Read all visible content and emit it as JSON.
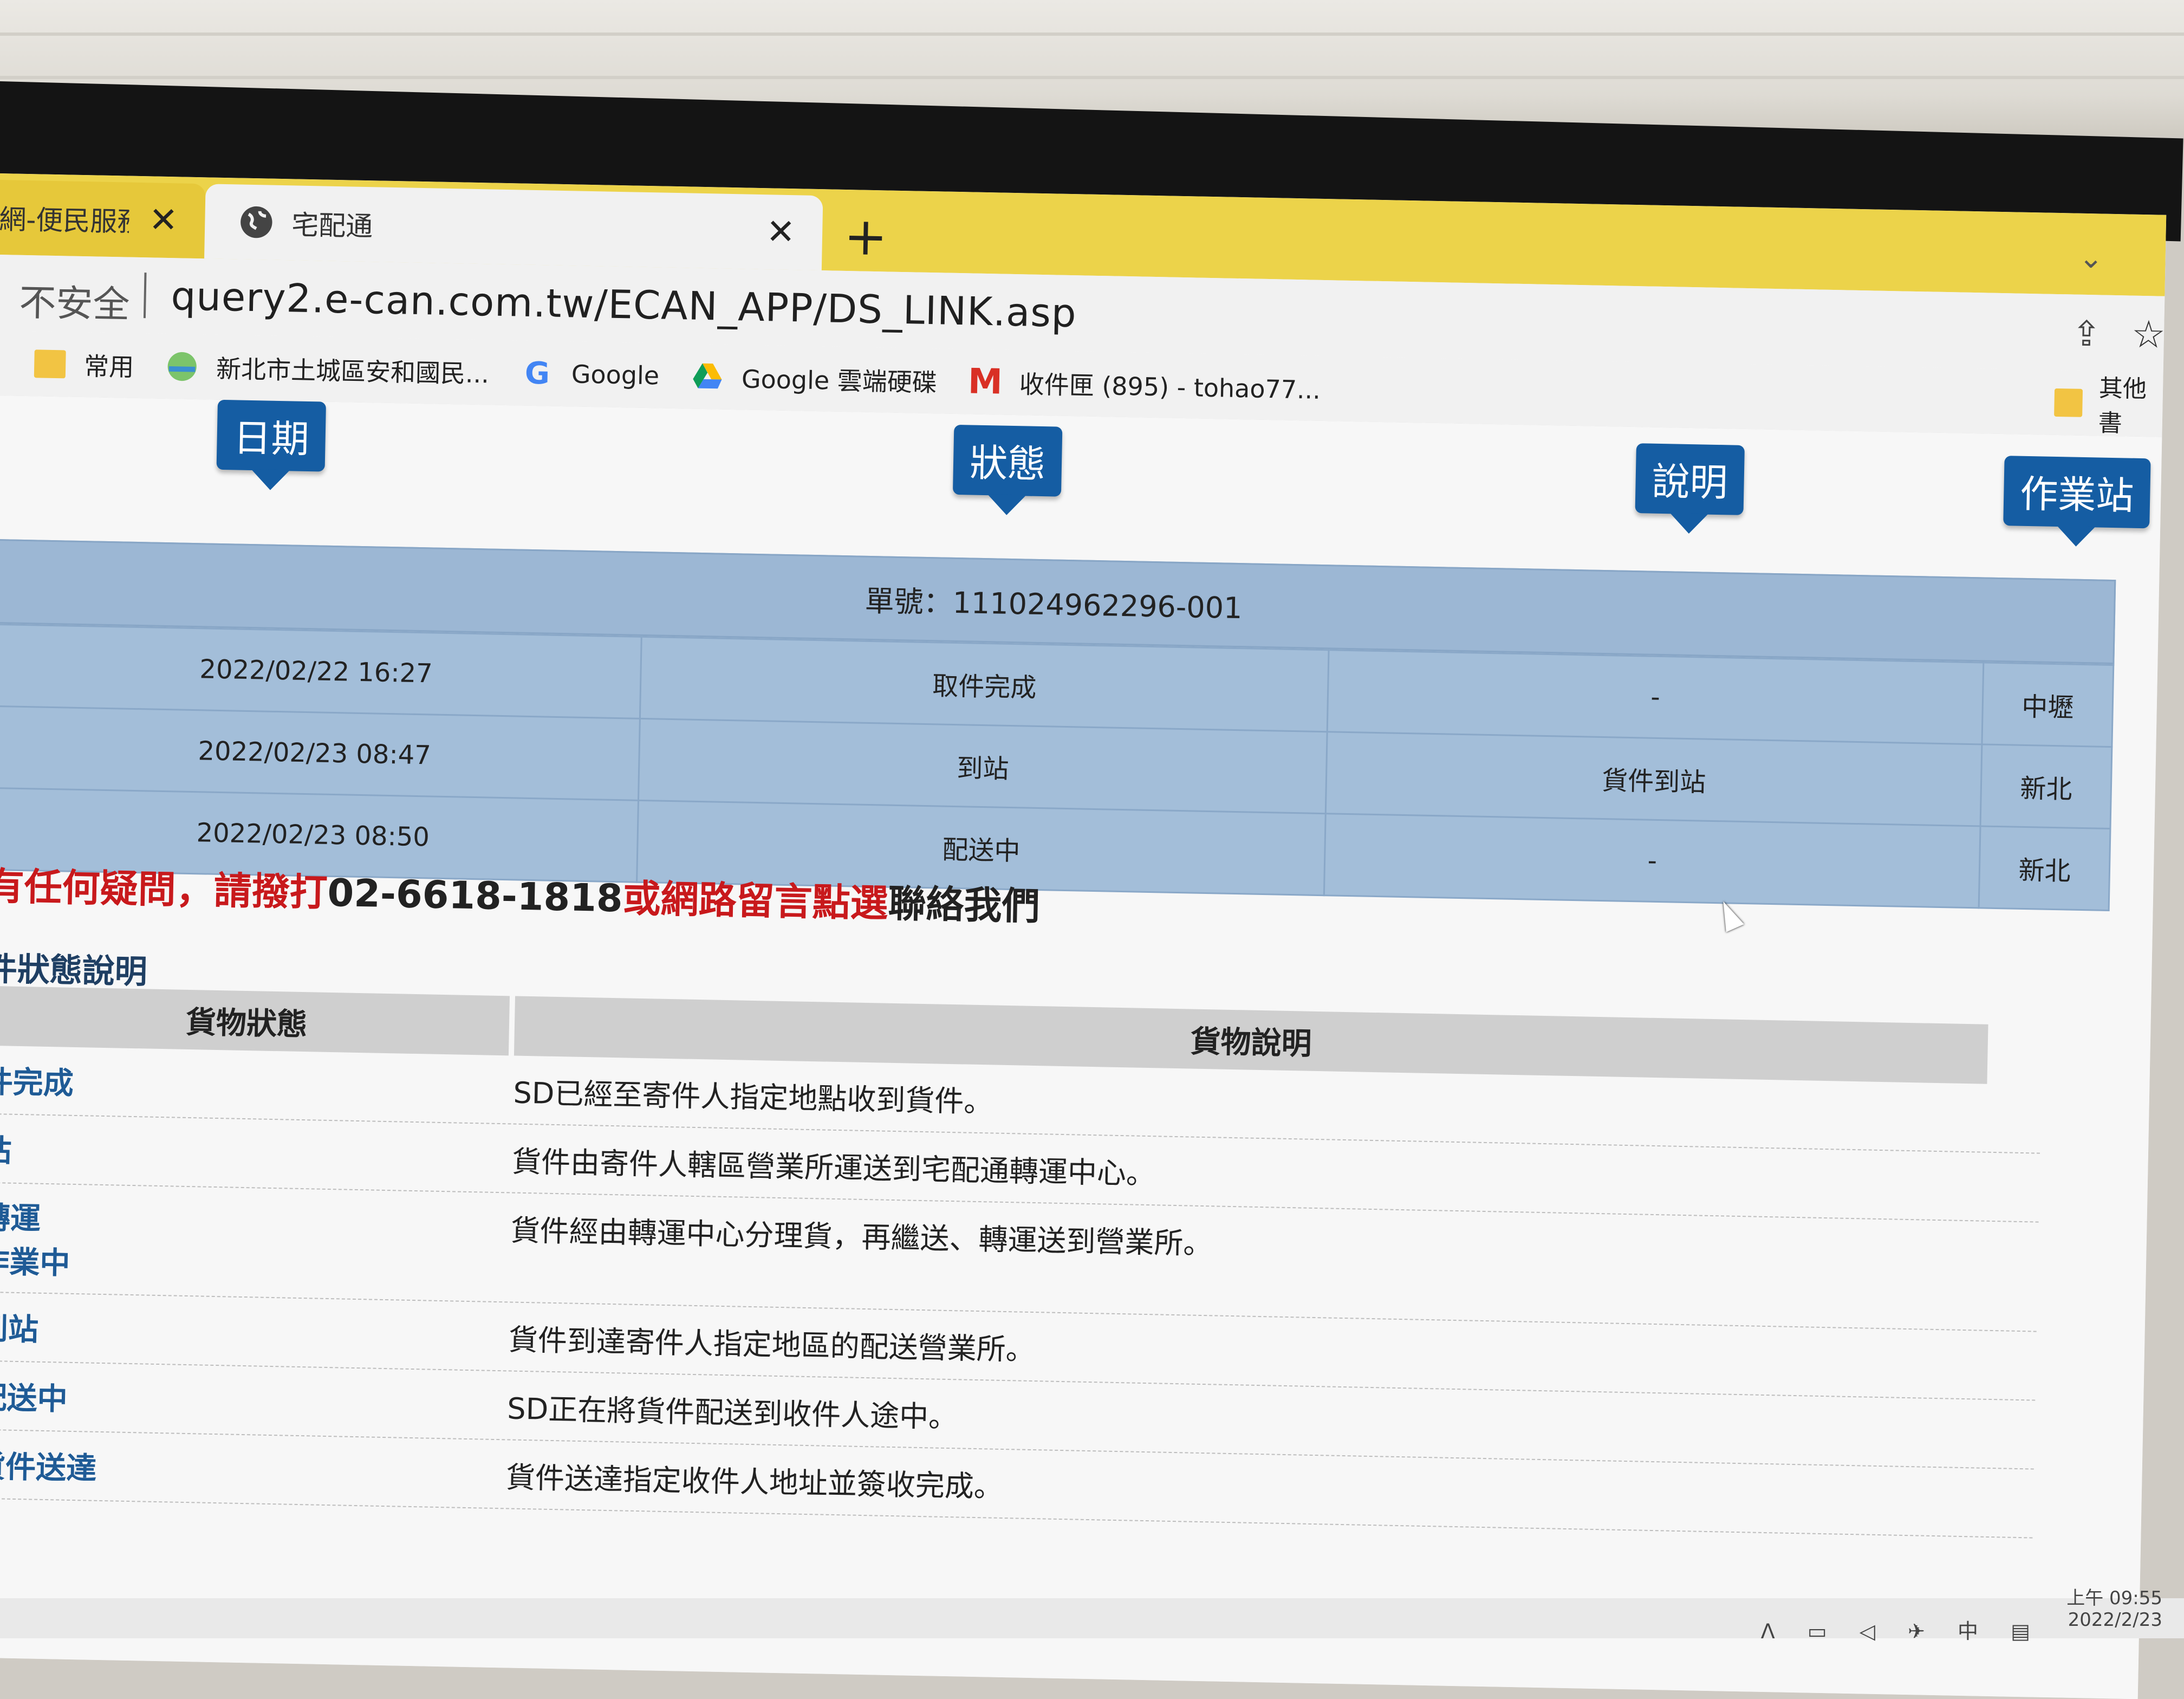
{
  "browser": {
    "tabs": [
      {
        "title": "網-便民服務",
        "close": "✕"
      },
      {
        "title": "宅配通",
        "close": "✕"
      }
    ],
    "new_tab": "+",
    "tab_menu": "⌄",
    "address": {
      "security": "不安全",
      "url": "query2.e-can.com.tw/ECAN_APP/DS_LINK.asp"
    },
    "bookmarks": [
      "常用",
      "新北市土城區安和國民...",
      "Google",
      "Google 雲端硬碟",
      "收件匣 (895) - tohao77..."
    ],
    "other_bookmarks": "其他書"
  },
  "tracking": {
    "columns": [
      "日期",
      "狀態",
      "說明",
      "作業站"
    ],
    "order_number": "單號：111024962296-001",
    "rows": [
      {
        "date": "2022/02/22 16:27",
        "status": "取件完成",
        "desc": "-",
        "station": "中壢"
      },
      {
        "date": "2022/02/23 08:47",
        "status": "到站",
        "desc": "貨件到站",
        "station": "新北"
      },
      {
        "date": "2022/02/23 08:50",
        "status": "配送中",
        "desc": "-",
        "station": "新北"
      }
    ]
  },
  "contact": {
    "part1": "有任何疑問，請撥打",
    "phone": "02-6618-1818",
    "part2": "或網路留言點選",
    "part3": "聯絡我們"
  },
  "legend": {
    "title": "件狀態說明",
    "headers": [
      "貨物狀態",
      "貨物說明"
    ],
    "rows": [
      {
        "status": "件完成",
        "desc": "SD已經至寄件人指定地點收到貨件。"
      },
      {
        "status": "站",
        "desc": "貨件由寄件人轄區營業所運送到宅配通轉運中心。"
      },
      {
        "status": "轉運",
        "status2": "作業中",
        "desc": "貨件經由轉運中心分理貨，再繼送、轉運送到營業所。"
      },
      {
        "status": "到站",
        "desc": "貨件到達寄件人指定地區的配送營業所。"
      },
      {
        "status": "配送中",
        "desc": "SD正在將貨件配送到收件人途中。"
      },
      {
        "status": "貨件送達",
        "desc": "貨件送達指定收件人地址並簽收完成。"
      }
    ]
  },
  "taskbar": {
    "time": "上午 09:55",
    "date": "2022/2/23",
    "tray": "ᐱ ▭ ◁ ✈ 中 ▤"
  },
  "colors": {
    "tab_bar": "#ecd34a",
    "callout": "#155da3",
    "tracking_bg": "#a3bed9",
    "alert_red": "#c8191c"
  }
}
